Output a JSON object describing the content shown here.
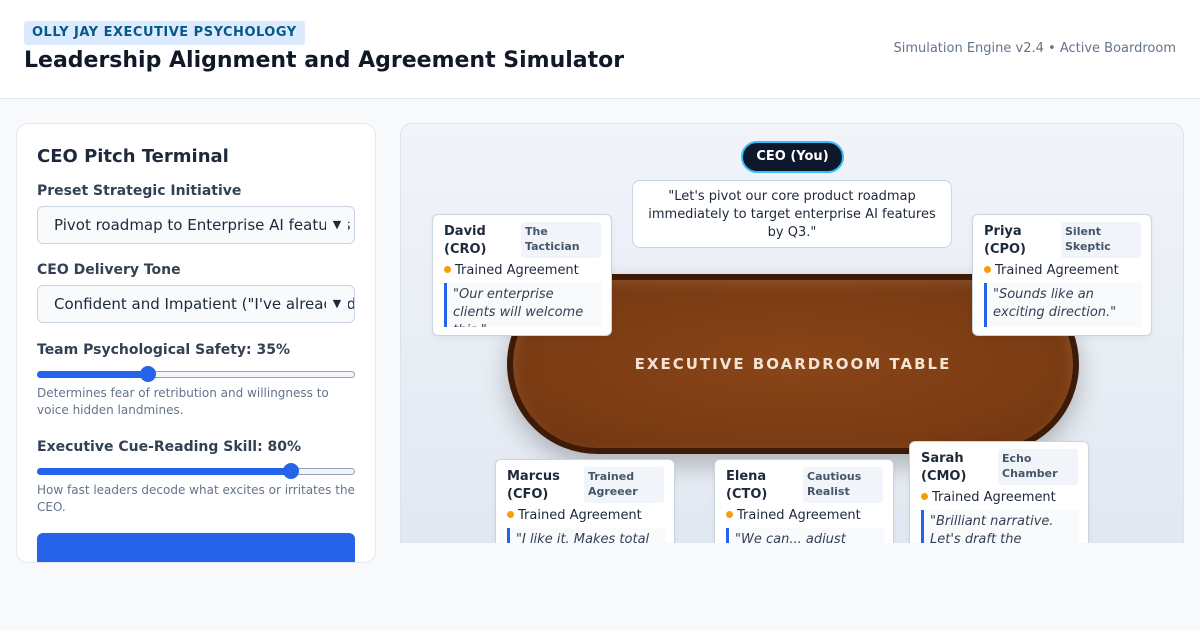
{
  "header": {
    "brand": "OLLY JAY EXECUTIVE PSYCHOLOGY",
    "title": "Leadership Alignment and Agreement Simulator",
    "engine_status": "Simulation Engine v2.4 • Active Boardroom"
  },
  "terminal": {
    "title": "CEO Pitch Terminal",
    "initiative_label": "Preset Strategic Initiative",
    "initiative_value": "Pivot roadmap to Enterprise AI features",
    "tone_label": "CEO Delivery Tone",
    "tone_value": "Confident and Impatient (\"I've already decided\")",
    "safety_label": "Team Psychological Safety: 35%",
    "safety_value": 35,
    "safety_help": "Determines fear of retribution and willingness to voice hidden landmines.",
    "cue_label": "Executive Cue-Reading Skill: 80%",
    "cue_value": 80,
    "cue_help": "How fast leaders decode what excites or irritates the CEO."
  },
  "boardroom": {
    "table_label": "EXECUTIVE BOARDROOM TABLE",
    "ceo_label": "CEO (You)",
    "ceo_pitch": "\"Let's pivot our core product roadmap immediately to target enterprise AI features by Q3.\"",
    "status_color": "#f59e0b",
    "executives": [
      {
        "name": "David (CRO)",
        "archetype": "The Tactician",
        "status": "Trained Agreement",
        "quote": "\"Our enterprise clients will welcome this.\""
      },
      {
        "name": "Priya (CPO)",
        "archetype": "Silent Skeptic",
        "status": "Trained Agreement",
        "quote": "\"Sounds like an exciting direction.\""
      },
      {
        "name": "Marcus (CFO)",
        "archetype": "Trained Agreeer",
        "status": "Trained Agreement",
        "quote": "\"I like it. Makes total sense.\""
      },
      {
        "name": "Elena (CTO)",
        "archetype": "Cautious Realist",
        "status": "Trained Agreement",
        "quote": "\"We can... adjust sprint priorities.\""
      },
      {
        "name": "Sarah (CMO)",
        "archetype": "Echo Chamber",
        "status": "Trained Agreement",
        "quote": "\"Brilliant narrative. Let's draft the announcement.\""
      }
    ]
  }
}
